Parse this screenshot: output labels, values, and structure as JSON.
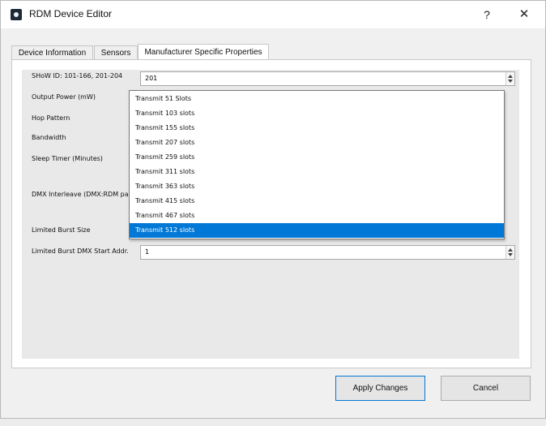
{
  "window": {
    "title": "RDM Device Editor",
    "help": "?",
    "close": "✕"
  },
  "tabs": [
    {
      "label": "Device Information"
    },
    {
      "label": "Sensors"
    },
    {
      "label": "Manufacturer Specific Properties",
      "active": true
    }
  ],
  "fields": {
    "show_id": {
      "label": "SHoW ID: 101-166, 201-204",
      "value": "201"
    },
    "output_power": {
      "label": "Output Power (mW)"
    },
    "hop_pattern": {
      "label": "Hop Pattern"
    },
    "bandwidth": {
      "label": "Bandwidth"
    },
    "sleep_timer": {
      "label": "Sleep Timer (Minutes)"
    },
    "dmx_interleave": {
      "label": "DMX Interleave (DMX:RDM packets)"
    },
    "limited_burst_size": {
      "label": "Limited Burst Size"
    },
    "limited_burst_start": {
      "label": "Limited Burst DMX Start Addr.",
      "value": "1"
    }
  },
  "dropdown": {
    "options": [
      "Transmit 51 Slots",
      "Transmit 103 slots",
      "Transmit 155 slots",
      "Transmit 207 slots",
      "Transmit 259 slots",
      "Transmit 311 slots",
      "Transmit 363 slots",
      "Transmit 415 slots",
      "Transmit 467 slots",
      "Transmit 512 slots"
    ],
    "selected_index": 9,
    "selected_color": "#0078d7"
  },
  "buttons": {
    "apply": "Apply Changes",
    "cancel": "Cancel"
  }
}
